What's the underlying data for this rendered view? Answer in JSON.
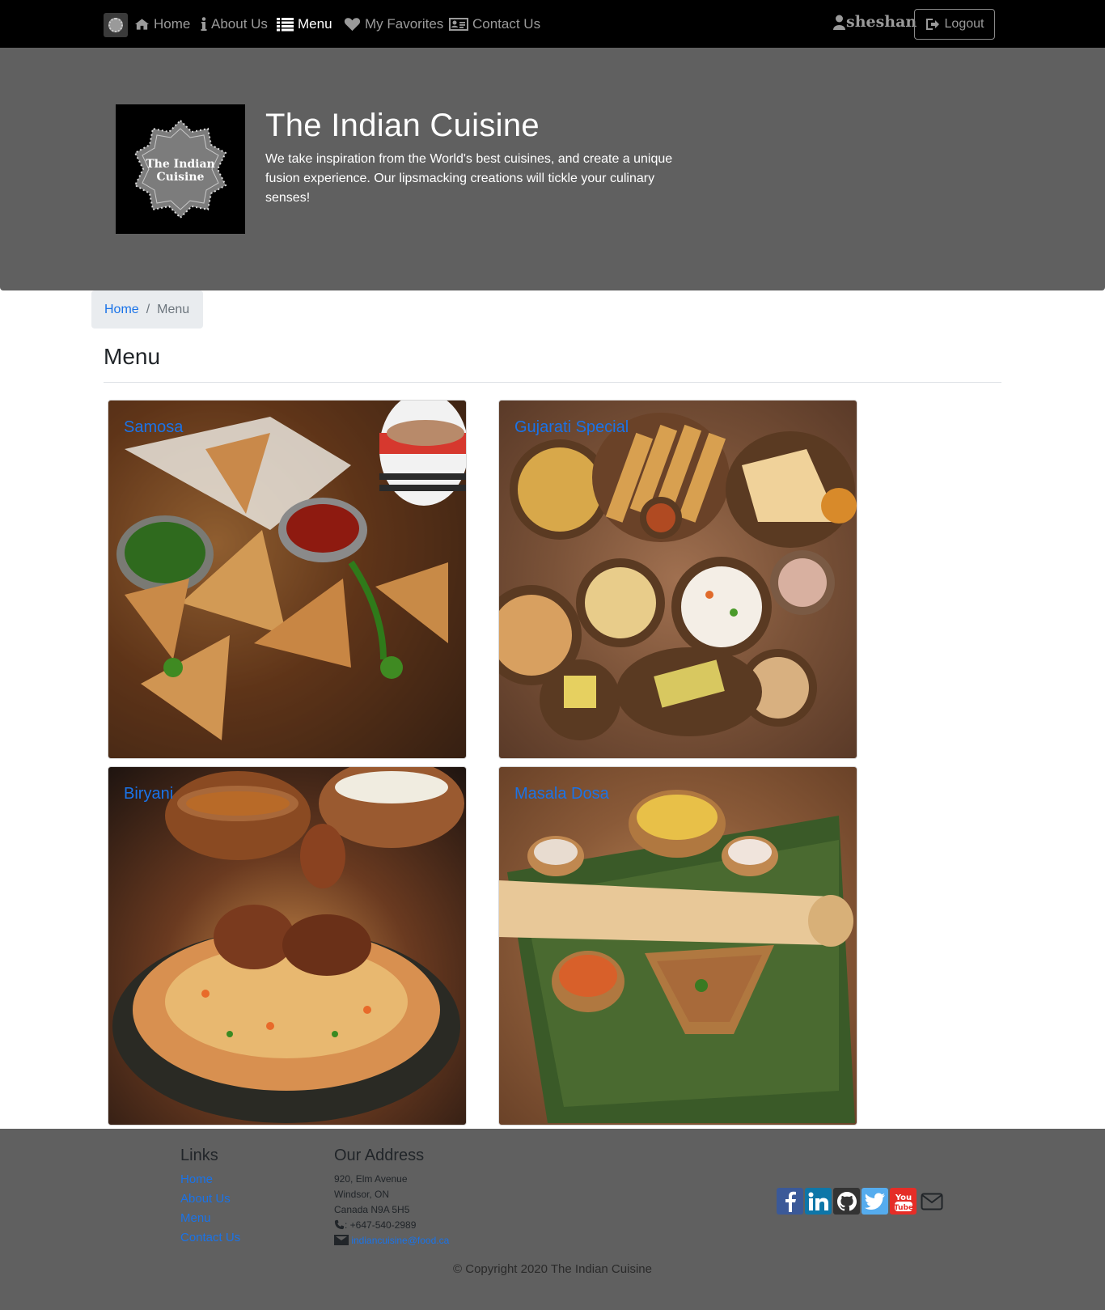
{
  "nav": {
    "items": [
      {
        "label": "Home",
        "icon": "home-icon"
      },
      {
        "label": "About Us",
        "icon": "info-icon"
      },
      {
        "label": "Menu",
        "icon": "list-icon",
        "active": true
      },
      {
        "label": "My Favorites",
        "icon": "heart-icon"
      },
      {
        "label": "Contact Us",
        "icon": "address-card-icon"
      }
    ],
    "username": "sheshan",
    "logout_label": "Logout"
  },
  "jumbotron": {
    "logo_text_line1": "The Indian",
    "logo_text_line2": "Cuisine",
    "title": "The Indian Cuisine",
    "subtitle": "We take inspiration from the World's best cuisines, and create a unique fusion experience. Our lipsmacking creations will tickle your culinary senses!"
  },
  "breadcrumb": {
    "home": "Home",
    "separator": "/",
    "current": "Menu"
  },
  "page_title": "Menu",
  "dishes": [
    {
      "name": "Samosa"
    },
    {
      "name": "Gujarati Special"
    },
    {
      "name": "Biryani"
    },
    {
      "name": "Masala Dosa"
    }
  ],
  "footer": {
    "links_heading": "Links",
    "links": [
      "Home",
      "About Us",
      "Menu",
      "Contact Us"
    ],
    "address_heading": "Our Address",
    "address_lines": [
      "920, Elm Avenue",
      "Windsor, ON",
      "Canada N9A 5H5"
    ],
    "phone": ": +647-540-2989",
    "email": "indiancuisine@food.ca",
    "copyright": "© Copyright 2020 The Indian Cuisine"
  },
  "colors": {
    "navbar_bg": "#000000",
    "jumbotron_bg": "#606060",
    "footer_bg": "#606060",
    "link": "#1a73e8",
    "facebook": "#3b5998",
    "linkedin": "#0e76a8",
    "github": "#333333",
    "twitter": "#55acee",
    "youtube": "#e52d27"
  }
}
